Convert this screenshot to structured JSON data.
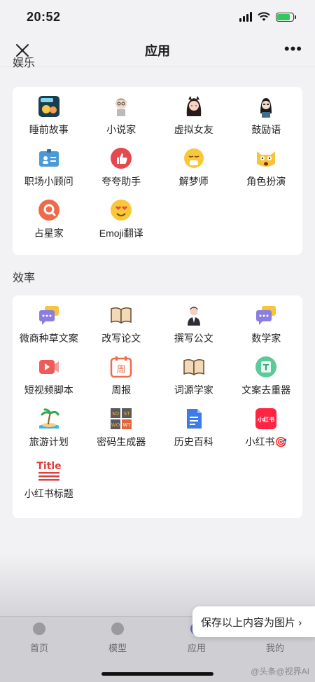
{
  "status": {
    "time": "20:52"
  },
  "nav": {
    "title": "应用",
    "more": "•••"
  },
  "sections": {
    "entertainment": {
      "title": "娱乐",
      "apps": [
        {
          "label": "睡前故事",
          "icon": "storybook-icon"
        },
        {
          "label": "小说家",
          "icon": "novelist-avatar-icon"
        },
        {
          "label": "虚拟女友",
          "icon": "girlfriend-avatar-icon"
        },
        {
          "label": "鼓励语",
          "icon": "encourager-avatar-icon"
        },
        {
          "label": "职场小顾问",
          "icon": "id-card-icon"
        },
        {
          "label": "夸夸助手",
          "icon": "thumbs-up-icon"
        },
        {
          "label": "解梦师",
          "icon": "sleepy-face-icon"
        },
        {
          "label": "角色扮演",
          "icon": "cat-face-icon"
        },
        {
          "label": "占星家",
          "icon": "astrology-icon"
        },
        {
          "label": "Emoji翻译",
          "icon": "heart-eyes-icon"
        }
      ]
    },
    "efficiency": {
      "title": "效率",
      "apps": [
        {
          "label": "微商种草文案",
          "icon": "chat-bubbles-icon"
        },
        {
          "label": "改写论文",
          "icon": "open-book-icon"
        },
        {
          "label": "撰写公文",
          "icon": "official-avatar-icon"
        },
        {
          "label": "数学家",
          "icon": "chat-bubbles-icon"
        },
        {
          "label": "短视频脚本",
          "icon": "video-icon"
        },
        {
          "label": "周报",
          "icon": "calendar-icon",
          "glyph": "周"
        },
        {
          "label": "词源学家",
          "icon": "open-book-icon"
        },
        {
          "label": "文案去重器",
          "icon": "text-dedupe-icon",
          "glyph": "T"
        },
        {
          "label": "旅游计划",
          "icon": "island-icon"
        },
        {
          "label": "密码生成器",
          "icon": "password-grid-icon",
          "grid": [
            "SO",
            "ST",
            "WO",
            "WT"
          ]
        },
        {
          "label": "历史百科",
          "icon": "document-icon"
        },
        {
          "label": "小红书🎯",
          "icon": "xiaohongshu-icon",
          "glyph": "小红书"
        },
        {
          "label": "小红书标题",
          "icon": "title-icon",
          "glyph": "Title"
        }
      ]
    }
  },
  "save_popup": "保存以上内容为图片 ›",
  "tabs": [
    {
      "label": "首页"
    },
    {
      "label": "模型"
    },
    {
      "label": "应用"
    },
    {
      "label": "我的"
    }
  ],
  "watermark": "@头条@视界AI",
  "colors": {
    "accent": "#34c759",
    "card": "#ffffff",
    "bg": "#f2f2f4"
  }
}
